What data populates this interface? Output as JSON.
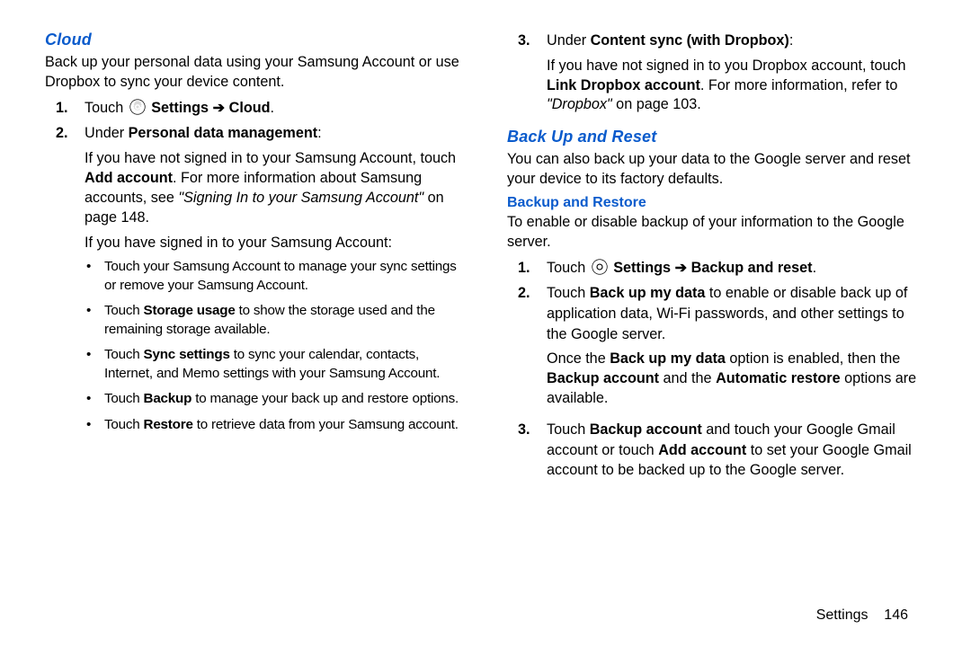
{
  "left": {
    "h_cloud": "Cloud",
    "cloud_intro": "Back up your personal data using your Samsung Account or use Dropbox to sync your device content.",
    "step1_prefix": "Touch ",
    "step1_settings": "Settings",
    "step1_arrow": " ➔ ",
    "step1_cloud": "Cloud",
    "step1_dot": ".",
    "step2_prefix": "Under ",
    "step2_pdm": "Personal data management",
    "step2_colon": ":",
    "pdm_p1a": "If you have not signed in to your Samsung Account, touch ",
    "pdm_p1b": "Add account",
    "pdm_p1c": ". For more information about Samsung accounts, see ",
    "pdm_p1d": "\"Signing In to your Samsung Account\"",
    "pdm_p1e": " on page 148.",
    "pdm_p2": "If you have signed in to your Samsung Account:",
    "b1": "Touch your Samsung Account to manage your sync settings or remove your Samsung Account.",
    "b2a": "Touch ",
    "b2b": "Storage usage",
    "b2c": " to show the storage used and the remaining storage available.",
    "b3a": "Touch ",
    "b3b": "Sync settings",
    "b3c": " to sync your calendar, contacts, Internet, and Memo settings with your Samsung Account.",
    "b4a": "Touch ",
    "b4b": "Backup",
    "b4c": " to manage your back up and restore options.",
    "b5a": "Touch ",
    "b5b": "Restore",
    "b5c": " to retrieve data from your Samsung account."
  },
  "right": {
    "step3_prefix": "Under ",
    "step3_b": "Content sync (with Dropbox)",
    "step3_colon": ":",
    "drop_a": "If you have not signed in to you Dropbox account, touch ",
    "drop_b": "Link Dropbox account",
    "drop_c": ". For more information, refer to ",
    "drop_d": "\"Dropbox\"",
    "drop_e": " on page 103.",
    "h_backup_reset": "Back Up and Reset",
    "bur_intro": "You can also back up your data to the Google server and reset your device to its factory defaults.",
    "h_backup_restore": "Backup and Restore",
    "bur_sub": "To enable or disable backup of your information to the Google server.",
    "r1_touch": "Touch ",
    "r1_settings": "Settings",
    "r1_arrow": " ➔ ",
    "r1_target": "Backup and reset",
    "r1_dot": ".",
    "r2a": "Touch ",
    "r2b": "Back up my data",
    "r2c": " to enable or disable back up of application data, Wi-Fi passwords, and other settings to the Google server.",
    "r2d_a": "Once the ",
    "r2d_b": "Back up my data",
    "r2d_c": " option is enabled, then the ",
    "r2d_d": "Backup account",
    "r2d_e": " and the ",
    "r2d_f": "Automatic restore",
    "r2d_g": " options are available.",
    "r3a": "Touch ",
    "r3b": "Backup account",
    "r3c": " and touch your Google Gmail account or touch ",
    "r3d": "Add account",
    "r3e": " to set your Google Gmail account to be backed up to the Google server."
  },
  "footer": {
    "section": "Settings",
    "page": "146"
  }
}
